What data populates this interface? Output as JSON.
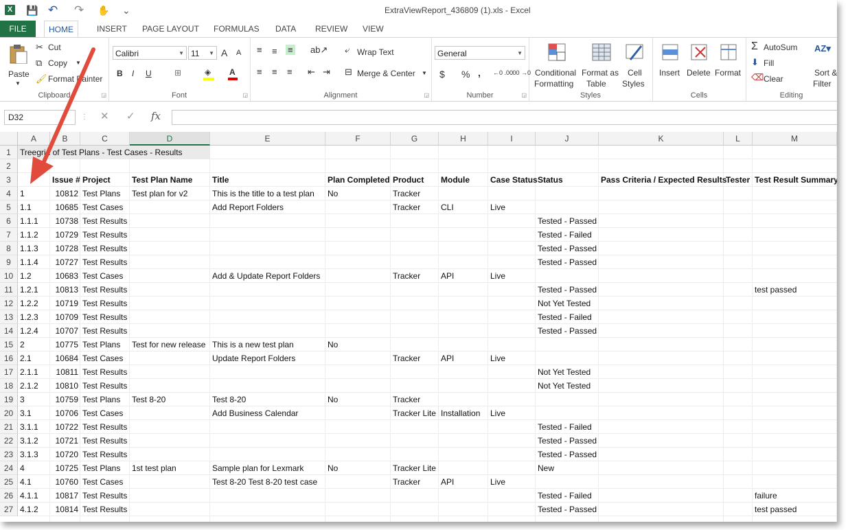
{
  "window": {
    "title": "ExtraViewReport_436809 (1).xls - Excel",
    "app_icon": "X"
  },
  "qat": {
    "save_icon": "💾",
    "undo_icon": "↶",
    "redo_icon": "↷",
    "touch_icon": "✋",
    "customize_icon": "⌄"
  },
  "tabs": [
    "FILE",
    "HOME",
    "INSERT",
    "PAGE LAYOUT",
    "FORMULAS",
    "DATA",
    "REVIEW",
    "VIEW"
  ],
  "ribbon": {
    "clipboard": {
      "label": "Clipboard",
      "paste": "Paste",
      "cut": "Cut",
      "copy": "Copy",
      "format_painter": "Format Painter"
    },
    "font": {
      "label": "Font",
      "font_name": "Calibri",
      "font_size": "11",
      "bold": "B",
      "italic": "I",
      "underline": "U",
      "grow": "A",
      "shrink": "A",
      "font_color": "A"
    },
    "alignment": {
      "label": "Alignment",
      "wrap_text": "Wrap Text",
      "merge_center": "Merge & Center"
    },
    "number": {
      "label": "Number",
      "format": "General",
      "currency": "$",
      "percent": "%",
      "comma": ","
    },
    "styles": {
      "label": "Styles",
      "conditional_formatting_1": "Conditional",
      "conditional_formatting_2": "Formatting",
      "format_as_table_1": "Format as",
      "format_as_table_2": "Table",
      "cell_styles_1": "Cell",
      "cell_styles_2": "Styles"
    },
    "cells": {
      "label": "Cells",
      "insert": "Insert",
      "delete": "Delete",
      "format": "Format"
    },
    "editing": {
      "label": "Editing",
      "autosum": "AutoSum",
      "fill": "Fill",
      "clear": "Clear",
      "sort_filter_1": "Sort &",
      "sort_filter_2": "Filter"
    }
  },
  "formula_bar": {
    "name_box": "D32",
    "cancel": "✕",
    "enter": "✓",
    "fx": "fx",
    "value": ""
  },
  "columns": [
    "A",
    "B",
    "C",
    "D",
    "E",
    "F",
    "G",
    "H",
    "I",
    "J",
    "K",
    "L",
    "M"
  ],
  "selected_column": "D",
  "rows": [
    {
      "n": "1",
      "A": "Treegrid of Test Plans - Test Cases - Results"
    },
    {
      "n": "2"
    },
    {
      "n": "3",
      "B": "Issue #",
      "C": "Project",
      "D": "Test Plan Name",
      "E": "Title",
      "F": "Plan Completed",
      "G": "Product",
      "H": "Module",
      "I": "Case Status",
      "J": "Status",
      "K": "Pass Criteria / Expected Results",
      "L": "Tester",
      "M": "Test Result Summary"
    },
    {
      "n": "4",
      "A": "1",
      "B": "10812",
      "C": "Test Plans",
      "D": "Test plan for v2",
      "E": "This is the title to a test plan",
      "F": "No",
      "G": "Tracker"
    },
    {
      "n": "5",
      "A": "1.1",
      "B": "10685",
      "C": "Test Cases",
      "E": "Add Report Folders",
      "G": "Tracker",
      "H": "CLI",
      "I": "Live"
    },
    {
      "n": "6",
      "A": "1.1.1",
      "B": "10738",
      "C": "Test Results",
      "J": "Tested - Passed"
    },
    {
      "n": "7",
      "A": "1.1.2",
      "B": "10729",
      "C": "Test Results",
      "J": "Tested - Failed"
    },
    {
      "n": "8",
      "A": "1.1.3",
      "B": "10728",
      "C": "Test Results",
      "J": "Tested - Passed"
    },
    {
      "n": "9",
      "A": "1.1.4",
      "B": "10727",
      "C": "Test Results",
      "J": "Tested - Passed"
    },
    {
      "n": "10",
      "A": "1.2",
      "B": "10683",
      "C": "Test Cases",
      "E": "Add & Update Report Folders",
      "G": "Tracker",
      "H": "API",
      "I": "Live"
    },
    {
      "n": "11",
      "A": "1.2.1",
      "B": "10813",
      "C": "Test Results",
      "J": "Tested - Passed",
      "M": "test passed"
    },
    {
      "n": "12",
      "A": "1.2.2",
      "B": "10719",
      "C": "Test Results",
      "J": "Not Yet Tested"
    },
    {
      "n": "13",
      "A": "1.2.3",
      "B": "10709",
      "C": "Test Results",
      "J": "Tested - Failed"
    },
    {
      "n": "14",
      "A": "1.2.4",
      "B": "10707",
      "C": "Test Results",
      "J": "Tested - Passed"
    },
    {
      "n": "15",
      "A": "2",
      "B": "10775",
      "C": "Test Plans",
      "D": "Test for new release",
      "E": "This is a new test plan",
      "F": "No"
    },
    {
      "n": "16",
      "A": "2.1",
      "B": "10684",
      "C": "Test Cases",
      "E": "Update Report Folders",
      "G": "Tracker",
      "H": "API",
      "I": "Live"
    },
    {
      "n": "17",
      "A": "2.1.1",
      "B": "10811",
      "C": "Test Results",
      "J": "Not Yet Tested"
    },
    {
      "n": "18",
      "A": "2.1.2",
      "B": "10810",
      "C": "Test Results",
      "J": "Not Yet Tested"
    },
    {
      "n": "19",
      "A": "3",
      "B": "10759",
      "C": "Test Plans",
      "D": "Test 8-20",
      "E": "Test 8-20",
      "F": "No",
      "G": "Tracker"
    },
    {
      "n": "20",
      "A": "3.1",
      "B": "10706",
      "C": "Test Cases",
      "E": "Add Business Calendar",
      "G": "Tracker Lite",
      "H": "Installation",
      "I": "Live"
    },
    {
      "n": "21",
      "A": "3.1.1",
      "B": "10722",
      "C": "Test Results",
      "J": "Tested - Failed"
    },
    {
      "n": "22",
      "A": "3.1.2",
      "B": "10721",
      "C": "Test Results",
      "J": "Tested - Passed"
    },
    {
      "n": "23",
      "A": "3.1.3",
      "B": "10720",
      "C": "Test Results",
      "J": "Tested - Passed"
    },
    {
      "n": "24",
      "A": "4",
      "B": "10725",
      "C": "Test Plans",
      "D": "1st test plan",
      "E": "Sample plan for Lexmark",
      "F": "No",
      "G": "Tracker Lite",
      "J": "New"
    },
    {
      "n": "25",
      "A": "4.1",
      "B": "10760",
      "C": "Test Cases",
      "E": "Test 8-20 Test 8-20 test case",
      "G": "Tracker",
      "H": "API",
      "I": "Live"
    },
    {
      "n": "26",
      "A": "4.1.1",
      "B": "10817",
      "C": "Test Results",
      "J": "Tested - Failed",
      "M": "failure"
    },
    {
      "n": "27",
      "A": "4.1.2",
      "B": "10814",
      "C": "Test Results",
      "J": "Tested - Passed",
      "M": "test passed"
    }
  ],
  "colors": {
    "excel_green": "#217346",
    "accent_blue": "#2b579a",
    "annotation_arrow": "#e04b3c"
  }
}
